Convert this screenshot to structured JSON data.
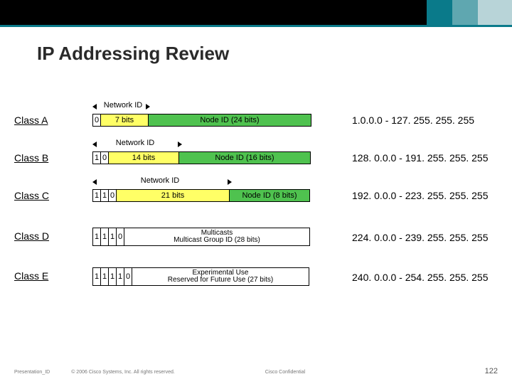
{
  "title": "IP Addressing Review",
  "labels": {
    "networkId": "Network ID"
  },
  "classes": {
    "A": {
      "label": "Class A",
      "prefix": [
        "0"
      ],
      "net": "7 bits",
      "node": "Node ID (24 bits)",
      "range": "1.0.0.0 - 127. 255. 255. 255"
    },
    "B": {
      "label": "Class B",
      "prefix": [
        "1",
        "0"
      ],
      "net": "14 bits",
      "node": "Node ID (16 bits)",
      "range": "128. 0.0.0 - 191. 255. 255. 255"
    },
    "C": {
      "label": "Class C",
      "prefix": [
        "1",
        "1",
        "0"
      ],
      "net": "21 bits",
      "node": "Node ID (8 bits)",
      "range": "192. 0.0.0 - 223. 255. 255. 255"
    },
    "D": {
      "label": "Class D",
      "prefix": [
        "1",
        "1",
        "1",
        "0"
      ],
      "line1": "Multicasts",
      "line2": "Multicast Group ID (28 bits)",
      "range": "224. 0.0.0 - 239. 255. 255. 255"
    },
    "E": {
      "label": "Class E",
      "prefix": [
        "1",
        "1",
        "1",
        "1",
        "0"
      ],
      "line1": "Experimental Use",
      "line2": "Reserved for Future Use (27 bits)",
      "range": "240. 0.0.0 - 254. 255. 255. 255"
    }
  },
  "footer": {
    "presId": "Presentation_ID",
    "copyright": "© 2006 Cisco Systems, Inc. All rights reserved.",
    "confidential": "Cisco Confidential",
    "page": "122"
  }
}
